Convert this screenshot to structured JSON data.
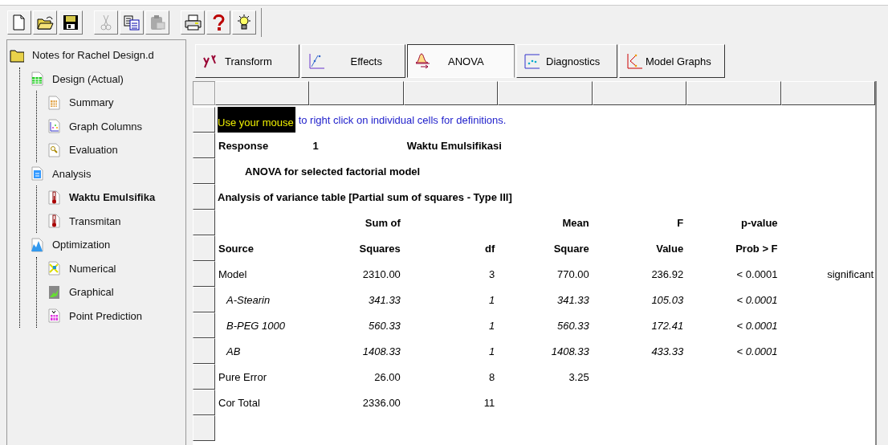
{
  "toolbar": [
    {
      "disabled": false
    },
    {
      "disabled": false
    },
    {
      "disabled": false
    },
    {
      "disabled": true
    },
    {
      "disabled": false
    },
    {
      "disabled": true
    },
    {
      "disabled": false
    },
    {
      "disabled": false
    },
    {
      "disabled": false
    }
  ],
  "tree": {
    "label": "Notes for Rachel Design.d",
    "selected": false,
    "children": [
      {
        "label": "Design (Actual)",
        "selected": false,
        "children": [
          {
            "label": "Summary",
            "selected": false
          },
          {
            "label": "Graph Columns",
            "selected": false
          },
          {
            "label": "Evaluation",
            "selected": false
          }
        ]
      },
      {
        "label": "Analysis",
        "selected": false,
        "children": [
          {
            "label": "Waktu Emulsifika",
            "selected": true
          },
          {
            "label": "Transmitan",
            "selected": false
          }
        ]
      },
      {
        "label": "Optimization",
        "selected": false,
        "children": [
          {
            "label": "Numerical",
            "selected": false
          },
          {
            "label": "Graphical",
            "selected": false
          },
          {
            "label": "Point Prediction",
            "selected": false
          }
        ]
      }
    ]
  },
  "tabs": [
    {
      "label": "Transform",
      "selected": false
    },
    {
      "label": "Effects",
      "selected": false
    },
    {
      "label": "ANOVA",
      "selected": true
    },
    {
      "label": "Diagnostics",
      "selected": false
    },
    {
      "label": "Model Graphs",
      "selected": false
    }
  ],
  "hint": {
    "highlighted": "Use your mouse",
    "text": "to right click on individual cells for definitions."
  },
  "response": {
    "label": "Response",
    "number": "1",
    "name": "Waktu Emulsifikasi"
  },
  "model_title": "ANOVA for selected factorial model",
  "table_title": "Analysis of variance table [Partial sum of squares - Type III]",
  "table": {
    "header_rows": [
      [
        "",
        "Sum of",
        "",
        "Mean",
        "F",
        "p-value",
        ""
      ],
      [
        "Source",
        "Squares",
        "df",
        "Square",
        "Value",
        "Prob > F",
        ""
      ]
    ],
    "rows": [
      {
        "kind": "summary",
        "cells": [
          "Model",
          "2310.00",
          "3",
          "770.00",
          "236.92",
          "< 0.0001",
          "significant"
        ]
      },
      {
        "kind": "term",
        "cells": [
          "A-Stearin",
          "341.33",
          "1",
          "341.33",
          "105.03",
          "< 0.0001",
          ""
        ]
      },
      {
        "kind": "term",
        "cells": [
          "B-PEG 1000",
          "560.33",
          "1",
          "560.33",
          "172.41",
          "< 0.0001",
          ""
        ]
      },
      {
        "kind": "term",
        "cells": [
          "AB",
          "1408.33",
          "1",
          "1408.33",
          "433.33",
          "< 0.0001",
          ""
        ]
      },
      {
        "kind": "summary",
        "cells": [
          "Pure Error",
          "26.00",
          "8",
          "3.25",
          "",
          "",
          ""
        ]
      },
      {
        "kind": "summary",
        "cells": [
          "Cor Total",
          "2336.00",
          "11",
          "",
          "",
          "",
          ""
        ]
      }
    ]
  }
}
